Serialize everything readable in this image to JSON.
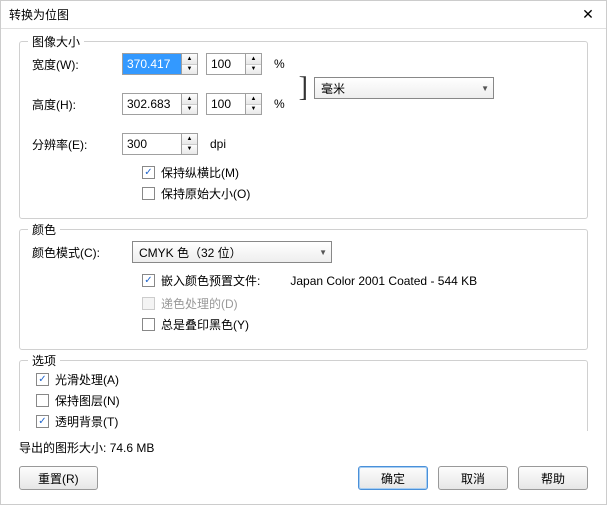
{
  "dialog": {
    "title": "转换为位图",
    "close": "✕"
  },
  "imageSize": {
    "groupTitle": "图像大小",
    "widthLabel": "宽度(W):",
    "widthValue": "370.417",
    "widthPercent": "100",
    "heightLabel": "高度(H):",
    "heightValue": "302.683",
    "heightPercent": "100",
    "percentUnit": "%",
    "resolutionLabel": "分辨率(E):",
    "resolutionValue": "300",
    "resolutionUnit": "dpi",
    "unitCombo": "毫米",
    "maintainRatio": "保持纵横比(M)",
    "maintainOriginal": "保持原始大小(O)"
  },
  "color": {
    "groupTitle": "颜色",
    "modeLabel": "颜色模式(C):",
    "modeValue": "CMYK 色（32 位）",
    "embedProfile": "嵌入颜色预置文件:",
    "profileInfo": "Japan Color 2001 Coated - 544 KB",
    "dither": "递色处理的(D)",
    "overprintBlack": "总是叠印黑色(Y)"
  },
  "options": {
    "groupTitle": "选项",
    "antialias": "光滑处理(A)",
    "keepLayers": "保持图层(N)",
    "transparentBg": "透明背景(T)"
  },
  "footer": {
    "exportSizeLabel": "导出的图形大小:",
    "exportSizeValue": "74.6 MB",
    "reset": "重置(R)",
    "ok": "确定",
    "cancel": "取消",
    "help": "帮助"
  }
}
